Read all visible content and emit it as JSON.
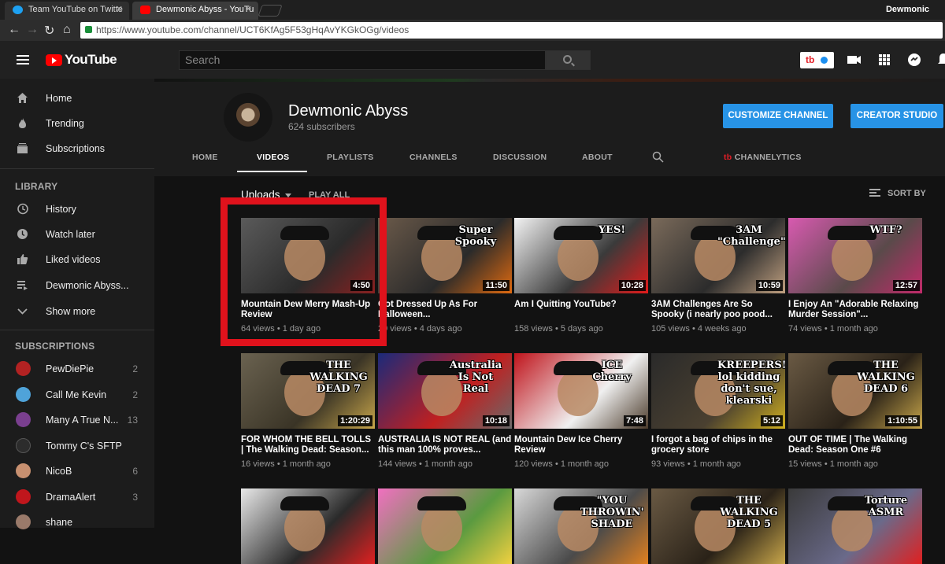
{
  "browser": {
    "tabs": [
      {
        "title": "Team YouTube on Twitte",
        "favicon_color": "#1da1f2"
      },
      {
        "title": "Dewmonic Abyss - YouTu",
        "favicon_color": "#ff0000"
      }
    ],
    "user": "Dewmonic",
    "url": "https://www.youtube.com/channel/UCT6KfAg5F53gHqAvYKGkOGg/videos"
  },
  "masthead": {
    "logo": "YouTube",
    "search_placeholder": "Search",
    "tb_label": "tb"
  },
  "sidebar": {
    "main": [
      {
        "label": "Home",
        "icon": "home-icon"
      },
      {
        "label": "Trending",
        "icon": "flame-icon"
      },
      {
        "label": "Subscriptions",
        "icon": "subscriptions-icon"
      }
    ],
    "library_heading": "LIBRARY",
    "library": [
      {
        "label": "History",
        "icon": "history-icon"
      },
      {
        "label": "Watch later",
        "icon": "clock-icon"
      },
      {
        "label": "Liked videos",
        "icon": "thumbs-up-icon"
      },
      {
        "label": "Dewmonic Abyss...",
        "icon": "playlist-icon"
      },
      {
        "label": "Show more",
        "icon": "chevron-down-icon"
      }
    ],
    "subscriptions_heading": "SUBSCRIPTIONS",
    "subscriptions": [
      {
        "label": "PewDiePie",
        "count": "2",
        "color": "#b22222"
      },
      {
        "label": "Call Me Kevin",
        "count": "2",
        "color": "#4fa3d9"
      },
      {
        "label": "Many A True N...",
        "count": "13",
        "color": "#7a3f8f"
      },
      {
        "label": "Tommy C's SFTP",
        "count": "",
        "color": "#2c2c2c"
      },
      {
        "label": "NicoB",
        "count": "6",
        "color": "#c89070"
      },
      {
        "label": "DramaAlert",
        "count": "3",
        "color": "#c0161c"
      },
      {
        "label": "shane",
        "count": "",
        "color": "#9a7a6a"
      }
    ]
  },
  "channel": {
    "name": "Dewmonic Abyss",
    "subscribers": "624 subscribers",
    "customize_label": "CUSTOMIZE CHANNEL",
    "studio_label": "CREATOR STUDIO",
    "tabs": [
      "HOME",
      "VIDEOS",
      "PLAYLISTS",
      "CHANNELS",
      "DISCUSSION",
      "ABOUT"
    ],
    "channelytics_label": "CHANNELYTICS",
    "channelytics_prefix": "tb"
  },
  "videos_header": {
    "uploads": "Uploads",
    "play_all": "PLAY ALL",
    "sort_by": "SORT BY"
  },
  "videos": [
    {
      "title": "Mountain Dew Merry Mash-Up Review",
      "meta": "64 views • 1 day ago",
      "duration": "4:50",
      "colors": [
        "#5a5a5a",
        "#2b2b2b",
        "#8a2020"
      ],
      "overlay": ""
    },
    {
      "title": "Got Dressed Up As For Halloween...",
      "meta": "29 views • 4 days ago",
      "duration": "11:50",
      "colors": [
        "#6b5a4a",
        "#2a2a2a",
        "#e06a10"
      ],
      "overlay": "Super Spooky"
    },
    {
      "title": "Am I Quitting YouTube?",
      "meta": "158 views • 5 days ago",
      "duration": "10:28",
      "colors": [
        "#f3f3f3",
        "#3a3a3a",
        "#e21b1b"
      ],
      "overlay": "YES!"
    },
    {
      "title": "3AM Challenges Are So Spooky (i nearly poo pood...",
      "meta": "105 views • 4 weeks ago",
      "duration": "10:59",
      "colors": [
        "#7a6a5a",
        "#2c2c2c",
        "#c0a080"
      ],
      "overlay": "3AM \"Challenge\""
    },
    {
      "title": "I Enjoy An \"Adorable Relaxing Murder Session\"...",
      "meta": "74 views • 1 month ago",
      "duration": "12:57",
      "colors": [
        "#d85ab0",
        "#5a4a4a",
        "#c22a6a"
      ],
      "overlay": "WTF?"
    },
    {
      "title": "FOR WHOM THE BELL TOLLS | The Walking Dead: Season...",
      "meta": "16 views • 1 month ago",
      "duration": "1:20:29",
      "colors": [
        "#6a6250",
        "#3a3426",
        "#c8a64a"
      ],
      "overlay": "THE WALKING DEAD 7"
    },
    {
      "title": "AUSTRALIA IS NOT REAL (and this man 100% proves...",
      "meta": "144 views • 1 month ago",
      "duration": "10:18",
      "colors": [
        "#1b2a7a",
        "#c02020",
        "#6a6a6a"
      ],
      "overlay": "Australia Is Not Real"
    },
    {
      "title": "Mountain Dew Ice Cherry Review",
      "meta": "120 views • 1 month ago",
      "duration": "7:48",
      "colors": [
        "#c0141c",
        "#f0f0f0",
        "#4a3a2a"
      ],
      "overlay": "ICE Cherry"
    },
    {
      "title": "I forgot a bag of chips in the grocery store",
      "meta": "93 views • 1 month ago",
      "duration": "5:12",
      "colors": [
        "#2a2a2a",
        "#4a4030",
        "#d0b020"
      ],
      "overlay": "KREEPERS! lol kidding don't sue, klearski"
    },
    {
      "title": "OUT OF TIME | The Walking Dead: Season One #6",
      "meta": "15 views • 1 month ago",
      "duration": "1:10:55",
      "colors": [
        "#6a5a44",
        "#2a2218",
        "#c8a64a"
      ],
      "overlay": "THE WALKING DEAD 6"
    },
    {
      "title": "",
      "meta": "",
      "duration": "",
      "colors": [
        "#e8e8e8",
        "#2a2a2a",
        "#e02020"
      ],
      "overlay": ""
    },
    {
      "title": "",
      "meta": "",
      "duration": "",
      "colors": [
        "#f070c0",
        "#5a9a40",
        "#f0d040"
      ],
      "overlay": ""
    },
    {
      "title": "",
      "meta": "",
      "duration": "",
      "colors": [
        "#d8d8d8",
        "#4a4a4a",
        "#e08020"
      ],
      "overlay": "\"YOU THROWIN' SHADE"
    },
    {
      "title": "",
      "meta": "",
      "duration": "",
      "colors": [
        "#6a5a44",
        "#2a2218",
        "#c8a64a"
      ],
      "overlay": "THE WALKING DEAD 5"
    },
    {
      "title": "",
      "meta": "",
      "duration": "",
      "colors": [
        "#3a3a3a",
        "#6a6a8a",
        "#e02020"
      ],
      "overlay": "Torture ASMR"
    }
  ],
  "highlight_color": "#e0121c"
}
